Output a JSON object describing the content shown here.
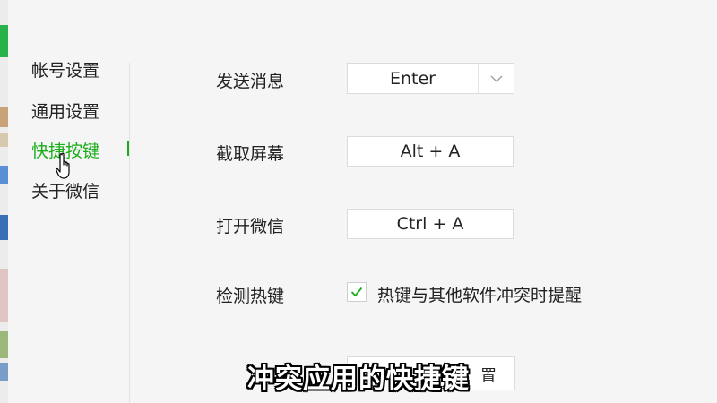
{
  "sidebar": {
    "items": [
      {
        "label": "帐号设置"
      },
      {
        "label": "通用设置"
      },
      {
        "label": "快捷按键"
      },
      {
        "label": "关于微信"
      }
    ],
    "active_index": 2,
    "accent_color": "#1aad19"
  },
  "settings": {
    "send_message": {
      "label": "发送消息",
      "value": "Enter",
      "dropdown_icon": "chevron-down-icon"
    },
    "screenshot": {
      "label": "截取屏幕",
      "value": "Alt + A"
    },
    "open_wechat": {
      "label": "打开微信",
      "value": "Ctrl + A"
    },
    "detect_hotkeys": {
      "label": "检测热键",
      "checkbox_label": "热键与其他软件冲突时提醒",
      "checked": true
    }
  },
  "bottom_button": {
    "label_partial": "置"
  },
  "subtitle": "冲突应用的快捷键"
}
